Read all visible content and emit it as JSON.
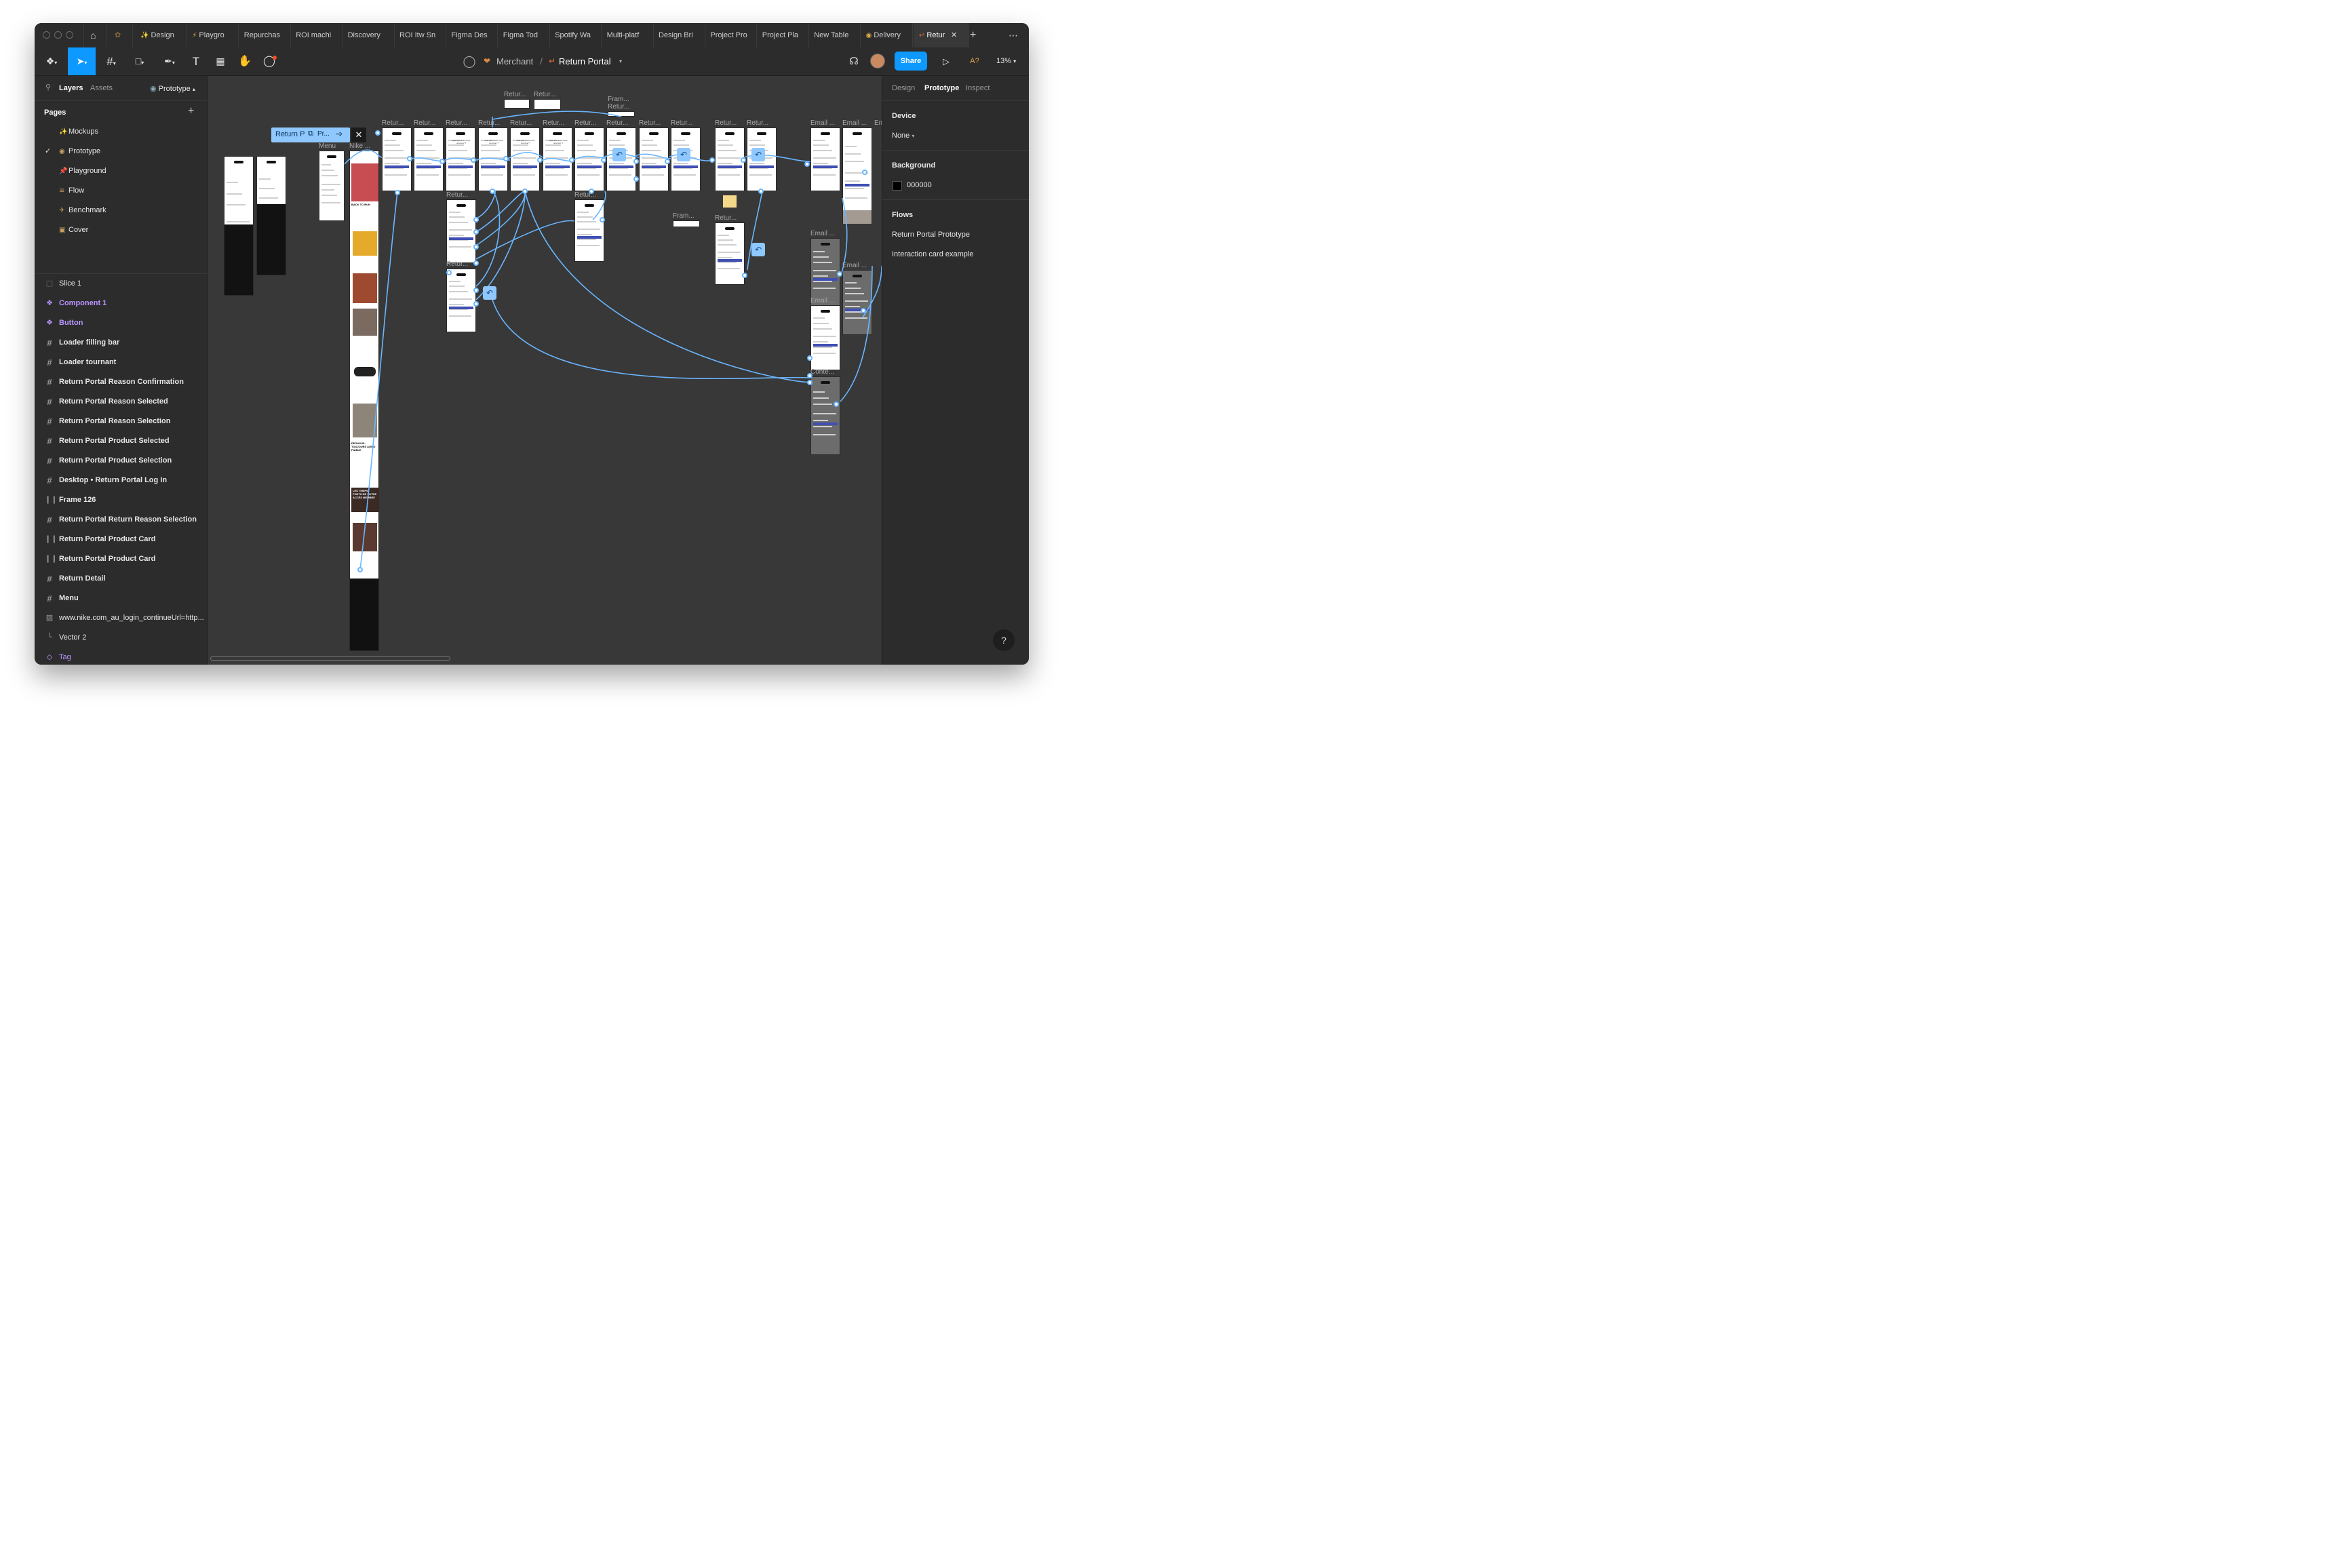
{
  "tabs": [
    {
      "label": "Design",
      "icon": "sparkle-icon"
    },
    {
      "label": "Playgro",
      "icon": "bolt-icon"
    },
    {
      "label": "Repurchas",
      "icon": ""
    },
    {
      "label": "ROI machi",
      "icon": ""
    },
    {
      "label": "Discovery",
      "icon": ""
    },
    {
      "label": "ROI Itw Sn",
      "icon": ""
    },
    {
      "label": "Figma Des",
      "icon": ""
    },
    {
      "label": "Figma Tod",
      "icon": ""
    },
    {
      "label": "Spotify Wa",
      "icon": ""
    },
    {
      "label": "Multi-platf",
      "icon": ""
    },
    {
      "label": "Design Bri",
      "icon": ""
    },
    {
      "label": "Project Pro",
      "icon": ""
    },
    {
      "label": "Project Pla",
      "icon": ""
    },
    {
      "label": "New Table",
      "icon": ""
    },
    {
      "label": "Delivery",
      "icon": "globe-icon"
    },
    {
      "label": "Retur",
      "icon": "return-icon"
    }
  ],
  "breadcrumb": {
    "team": "Merchant",
    "separator": "/",
    "file": "Return Portal"
  },
  "toolbar": {
    "share_label": "Share",
    "zoom": "13%",
    "autofix": "A?"
  },
  "left_panel": {
    "tabs": [
      "Layers",
      "Assets"
    ],
    "page_switch": "Prototype",
    "pages_title": "Pages",
    "pages": [
      {
        "label": "Mockups",
        "icon": "sparkle-icon",
        "current": false
      },
      {
        "label": "Prototype",
        "icon": "globe-icon",
        "current": true
      },
      {
        "label": "Playground",
        "icon": "pin-icon",
        "current": false
      },
      {
        "label": "Flow",
        "icon": "wave-icon",
        "current": false
      },
      {
        "label": "Benchmark",
        "icon": "runner-icon",
        "current": false
      },
      {
        "label": "Cover",
        "icon": "image-icon",
        "current": false
      }
    ],
    "layers": [
      {
        "label": "Slice 1",
        "type": "slice"
      },
      {
        "label": "Component 1",
        "type": "component"
      },
      {
        "label": "Button",
        "type": "component"
      },
      {
        "label": "Loader filling bar",
        "type": "frame"
      },
      {
        "label": "Loader tournant",
        "type": "frame"
      },
      {
        "label": "Return Portal Reason Confirmation",
        "type": "frame"
      },
      {
        "label": "Return Portal Reason Selected",
        "type": "frame"
      },
      {
        "label": "Return Portal Reason Selection",
        "type": "frame"
      },
      {
        "label": "Return Portal Product Selected",
        "type": "frame"
      },
      {
        "label": "Return Portal Product Selection",
        "type": "frame"
      },
      {
        "label": "Desktop • Return Portal Log In",
        "type": "frame"
      },
      {
        "label": "Frame 126",
        "type": "autolayout"
      },
      {
        "label": "Return Portal Return Reason Selection",
        "type": "frame"
      },
      {
        "label": "Return Portal Product Card",
        "type": "autolayout"
      },
      {
        "label": "Return Portal Product Card",
        "type": "autolayout"
      },
      {
        "label": "Return Detail",
        "type": "frame"
      },
      {
        "label": "Menu",
        "type": "frame"
      },
      {
        "label": "www.nike.com_au_login_continueUrl=http...",
        "type": "image"
      },
      {
        "label": "Vector 2",
        "type": "vector"
      },
      {
        "label": "Tag",
        "type": "tag"
      },
      {
        "label": "Tag",
        "type": "tag"
      }
    ]
  },
  "canvas": {
    "selection_label": "Return P",
    "selection_sub": "Pr...",
    "labels": {
      "menu": "Menu",
      "nike": "Nike ...",
      "retur": "Retur...",
      "fram": "Fram...",
      "email": "Email ...",
      "emaill": "Email ...",
      "conte": "Conte..."
    },
    "mock_texts": {
      "title": "Que souhaitez-vous renvoyer ?",
      "nike_hero": "BACK TO RUN",
      "pegasus": "PEGASUS : TOUJOURS AUSSI FIABLE",
      "les_temps": "LES TEMPS FORTS DE VOTRE ACCÈS MEMBRE"
    }
  },
  "right_panel": {
    "tabs": [
      "Design",
      "Prototype",
      "Inspect"
    ],
    "active_tab": "Prototype",
    "device_title": "Device",
    "device_value": "None",
    "background_title": "Background",
    "background_hex": "000000",
    "flows_title": "Flows",
    "flows": [
      "Return Portal Prototype",
      "Interaction card example"
    ]
  },
  "help_label": "?",
  "colors": {
    "accent": "#0d99ff",
    "component": "#b895ff",
    "connector": "#6ab6ff"
  }
}
